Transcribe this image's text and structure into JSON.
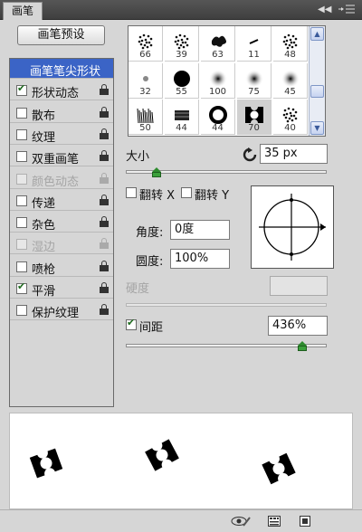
{
  "window": {
    "tab_title": "画笔",
    "collapse_icon": "double-chevron-left-icon",
    "menu_icon": "panel-menu-icon"
  },
  "brush_presets_button": "画笔预设",
  "options": [
    {
      "label": "画笔笔尖形状",
      "checkbox": false,
      "checked": false,
      "lock": false,
      "disabled": false,
      "selected": true
    },
    {
      "label": "形状动态",
      "checkbox": true,
      "checked": true,
      "lock": true,
      "disabled": false
    },
    {
      "label": "散布",
      "checkbox": true,
      "checked": false,
      "lock": true,
      "disabled": false
    },
    {
      "label": "纹理",
      "checkbox": true,
      "checked": false,
      "lock": true,
      "disabled": false
    },
    {
      "label": "双重画笔",
      "checkbox": true,
      "checked": false,
      "lock": true,
      "disabled": false
    },
    {
      "label": "颜色动态",
      "checkbox": true,
      "checked": false,
      "lock": true,
      "disabled": true
    },
    {
      "label": "传递",
      "checkbox": true,
      "checked": false,
      "lock": true,
      "disabled": false
    },
    {
      "label": "杂色",
      "checkbox": true,
      "checked": false,
      "lock": true,
      "disabled": false
    },
    {
      "label": "湿边",
      "checkbox": true,
      "checked": false,
      "lock": true,
      "disabled": true
    },
    {
      "label": "喷枪",
      "checkbox": true,
      "checked": false,
      "lock": true,
      "disabled": false
    },
    {
      "label": "平滑",
      "checkbox": true,
      "checked": true,
      "lock": true,
      "disabled": false
    },
    {
      "label": "保护纹理",
      "checkbox": true,
      "checked": false,
      "lock": true,
      "disabled": false
    }
  ],
  "brush_tips": [
    {
      "size": "66",
      "shape": "scatter"
    },
    {
      "size": "39",
      "shape": "scatter"
    },
    {
      "size": "63",
      "shape": "splat"
    },
    {
      "size": "11",
      "shape": "dash"
    },
    {
      "size": "48",
      "shape": "scatter"
    },
    {
      "size": "32",
      "shape": "soft-dots"
    },
    {
      "size": "55",
      "shape": "hard-round"
    },
    {
      "size": "100",
      "shape": "soft-round"
    },
    {
      "size": "75",
      "shape": "soft-round"
    },
    {
      "size": "45",
      "shape": "soft-round"
    },
    {
      "size": "50",
      "shape": "grass"
    },
    {
      "size": "44",
      "shape": "chalk"
    },
    {
      "size": "44",
      "shape": "ring"
    },
    {
      "size": "70",
      "shape": "ticket"
    },
    {
      "size": "40",
      "shape": "scatter"
    }
  ],
  "selected_tip_index": 13,
  "size": {
    "label": "大小",
    "value": "35 px",
    "slider_pct": 15,
    "reset_icon": "reset-size-icon"
  },
  "flip_x": {
    "label": "翻转 X",
    "checked": false
  },
  "flip_y": {
    "label": "翻转 Y",
    "checked": false
  },
  "angle": {
    "label": "角度:",
    "value": "0度"
  },
  "roundness": {
    "label": "圆度:",
    "value": "100%"
  },
  "hardness": {
    "label": "硬度",
    "value": "",
    "disabled": true
  },
  "spacing": {
    "label": "间距",
    "checked": true,
    "value": "436%",
    "slider_pct": 88
  },
  "bottom_icons": [
    "eye-toggle-icon",
    "brush-panel-icon",
    "new-preset-icon"
  ]
}
